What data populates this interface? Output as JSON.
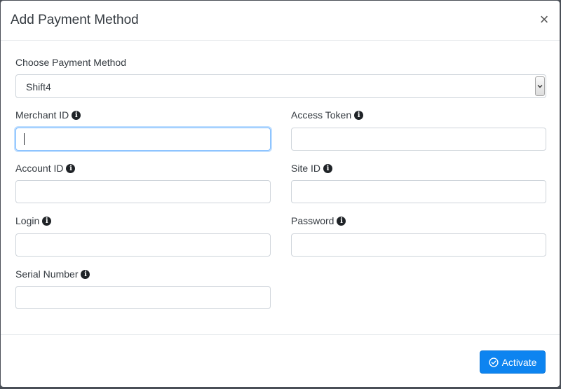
{
  "modal": {
    "title": "Add Payment Method",
    "close_label": "×"
  },
  "payment_method": {
    "label": "Choose Payment Method",
    "selected": "Shift4"
  },
  "fields": {
    "merchant_id": {
      "label": "Merchant ID",
      "value": ""
    },
    "access_token": {
      "label": "Access Token",
      "value": ""
    },
    "account_id": {
      "label": "Account ID",
      "value": ""
    },
    "site_id": {
      "label": "Site ID",
      "value": ""
    },
    "login": {
      "label": "Login",
      "value": ""
    },
    "password": {
      "label": "Password",
      "value": ""
    },
    "serial_number": {
      "label": "Serial Number",
      "value": ""
    }
  },
  "info_icon_glyph": "i",
  "footer": {
    "activate_label": "Activate"
  },
  "colors": {
    "primary": "#0d84f0",
    "focus_border": "#80bdff",
    "icon": "#1f2327"
  },
  "icons": {
    "info": "info-circle-icon",
    "activate": "check-circle-icon",
    "select_arrow": "chevron-down-icon",
    "close": "close-icon"
  }
}
